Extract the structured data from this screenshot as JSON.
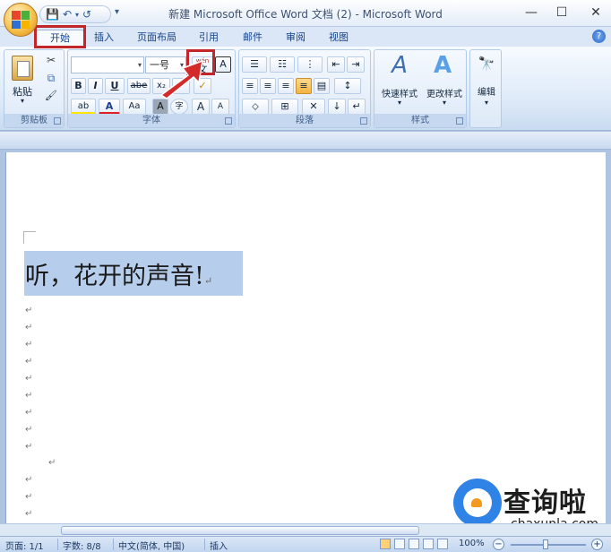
{
  "window": {
    "title": "新建 Microsoft Office Word 文档 (2) - Microsoft Word",
    "controls": {
      "minimize": "—",
      "maximize": "☐",
      "close": "✕"
    }
  },
  "quick_access": {
    "save_icon": "💾",
    "undo_icon": "↶",
    "undo_arrow": "▾",
    "redo_icon": "↺",
    "more_arrow": "▾"
  },
  "tabs": [
    "开始",
    "插入",
    "页面布局",
    "引用",
    "邮件",
    "审阅",
    "视图"
  ],
  "help_label": "?",
  "ribbon": {
    "clipboard": {
      "label": "剪贴板",
      "paste_label": "粘贴",
      "paste_arrow": "▾",
      "cut_icon": "✂",
      "copy_icon": "⧉",
      "format_painter_icon": "🖌"
    },
    "font": {
      "label": "字体",
      "font_name": "",
      "font_size": "一号",
      "phonetic_label": "wén",
      "phonetic_char": "文",
      "border_char": "A",
      "bold": "B",
      "italic": "I",
      "underline": "U",
      "strikethrough": "abe",
      "subscript": "x₂",
      "superscript": "x²",
      "clear_format": "✓",
      "highlight": "ab",
      "font_color": "A",
      "change_case": "Aa",
      "char_shading": "A",
      "enclose": "字",
      "grow": "A",
      "shrink": "A",
      "dropdown": "▾"
    },
    "paragraph": {
      "label": "段落",
      "row1": [
        "☰",
        "☷",
        "⋮",
        "⇤",
        "⇥"
      ],
      "row2": [
        "≡",
        "≡",
        "≡",
        "≡",
        "▤",
        "↕"
      ],
      "row3": [
        "⬦",
        "⊞",
        "✕",
        "↓",
        "↵"
      ]
    },
    "styles": {
      "label": "样式",
      "quick_styles": "快速样式",
      "change_styles": "更改样式",
      "style_glyph": "A"
    },
    "editing": {
      "label": "编辑",
      "icon": "🔭",
      "arrow": "▾"
    }
  },
  "document": {
    "text": "听，花开的声音!",
    "end_mark": "↵",
    "para_mark": "↵"
  },
  "watermark": {
    "cn": "查询啦",
    "en": "chaxunla.com"
  },
  "status": {
    "page": "页面: 1/1",
    "words": "字数: 8/8",
    "language": "中文(简体, 中国)",
    "mode": "插入",
    "zoom": "100%",
    "zoom_out": "−",
    "zoom_in": "+"
  }
}
